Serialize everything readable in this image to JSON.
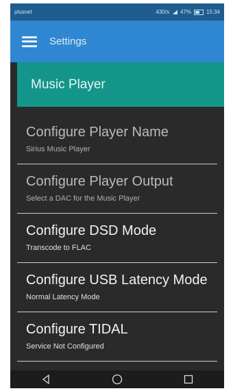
{
  "status_bar": {
    "carrier": "plusnet",
    "info": "430/s",
    "battery_percent": "47%",
    "time": "15:34"
  },
  "app_bar": {
    "title": "Settings",
    "menu_icon": "hamburger-menu-icon"
  },
  "section": {
    "title": "Music Player",
    "color": "#14958a"
  },
  "settings_items": [
    {
      "title": "Configure Player Name",
      "subtitle": "Sirius Music Player"
    },
    {
      "title": "Configure Player Output",
      "subtitle": "Select a DAC for the Music Player"
    },
    {
      "title": "Configure DSD Mode",
      "subtitle": "Transcode to FLAC"
    },
    {
      "title": "Configure USB Latency Mode",
      "subtitle": "Normal Latency Mode"
    },
    {
      "title": "Configure TIDAL",
      "subtitle": "Service Not Configured"
    }
  ],
  "nav_bar": {
    "back_icon": "back-triangle-icon",
    "home_icon": "home-circle-icon",
    "recents_icon": "recents-square-icon"
  },
  "colors": {
    "app_bar": "#2f87d1",
    "status_bar": "#1f5c8f",
    "background": "#2a2a2a"
  }
}
